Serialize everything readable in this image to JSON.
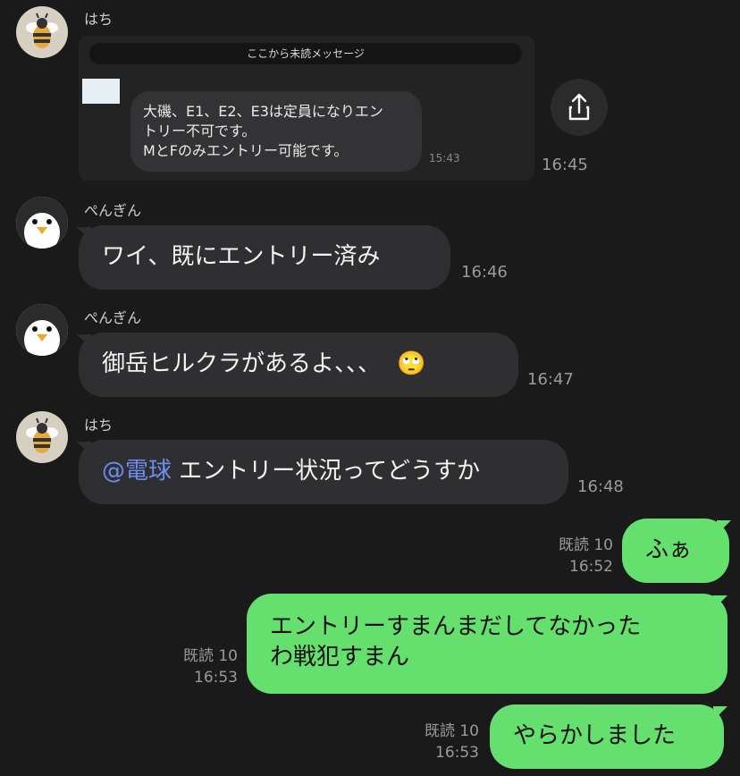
{
  "messages": [
    {
      "sender": "はち",
      "avatar": "bee-icon",
      "quoted": {
        "unread_label": "ここから未読メッセージ",
        "text_line1": "大磯、E1、E2、E3は定員になりエン",
        "text_line2": "トリー不可です。",
        "text_line3": "MとFのみエントリー可能です。",
        "time": "15:43"
      },
      "time": "16:45"
    },
    {
      "sender": "ぺんぎん",
      "avatar": "penguin-icon",
      "text": "ワイ、既にエントリー済み",
      "time": "16:46"
    },
    {
      "sender": "ぺんぎん",
      "avatar": "penguin-icon",
      "text": "御岳ヒルクラがあるよ、、、",
      "emoji": "🙄",
      "time": "16:47"
    },
    {
      "sender": "はち",
      "avatar": "bee-icon",
      "mention": "@電球",
      "text": " エントリー状況ってどうすか",
      "time": "16:48"
    }
  ],
  "my_messages": [
    {
      "read": "既読 10",
      "time": "16:52",
      "text": "ふぁ"
    },
    {
      "read": "既読 10",
      "time": "16:53",
      "line1": "エントリーすまんまだしてなかった",
      "line2": "わ戦犯すまん"
    },
    {
      "read": "既読 10",
      "time": "16:53",
      "text": "やらかしました"
    }
  ],
  "colors": {
    "background": "#1a1a1a",
    "bubble_other": "#2f2f31",
    "bubble_me": "#65df6d",
    "mention": "#6d8df0"
  }
}
